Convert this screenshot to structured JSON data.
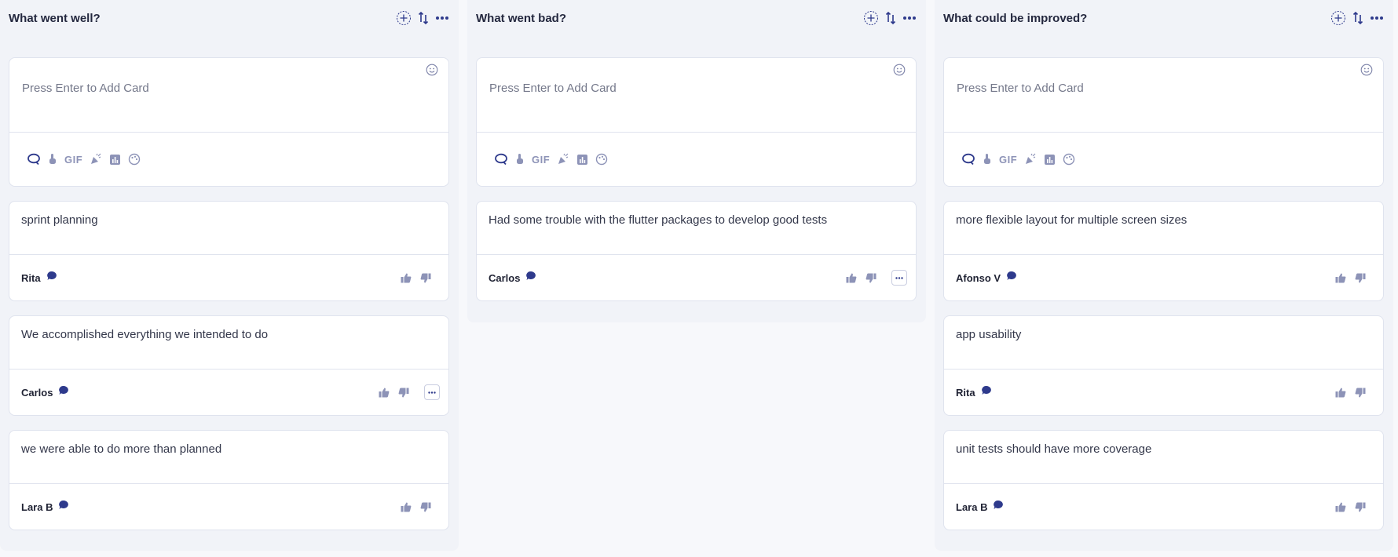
{
  "add_placeholder": "Press Enter to Add Card",
  "toolbar": {
    "gif_label": "GIF"
  },
  "columns": [
    {
      "title": "What went well?",
      "cards": [
        {
          "text": "sprint planning",
          "author": "Rita"
        },
        {
          "text": "We accomplished everything we intended to do",
          "author": "Carlos",
          "more_label": "···"
        },
        {
          "text": "we were able to do more than planned",
          "author": "Lara B"
        }
      ]
    },
    {
      "title": "What went bad?",
      "cards": [
        {
          "text": "Had some trouble with the flutter packages to develop good tests",
          "author": "Carlos",
          "more_label": "···"
        }
      ]
    },
    {
      "title": "What could be improved?",
      "cards": [
        {
          "text": "more flexible layout for multiple screen sizes",
          "author": "Afonso V"
        },
        {
          "text": "app usability",
          "author": "Rita"
        },
        {
          "text": "unit tests should have more coverage",
          "author": "Lara B"
        }
      ]
    }
  ],
  "colors": {
    "accent": "#2e3a8c",
    "muted_icon": "#8d93b7",
    "border": "#dfe3ee",
    "column_bg": "#f1f3f8"
  }
}
